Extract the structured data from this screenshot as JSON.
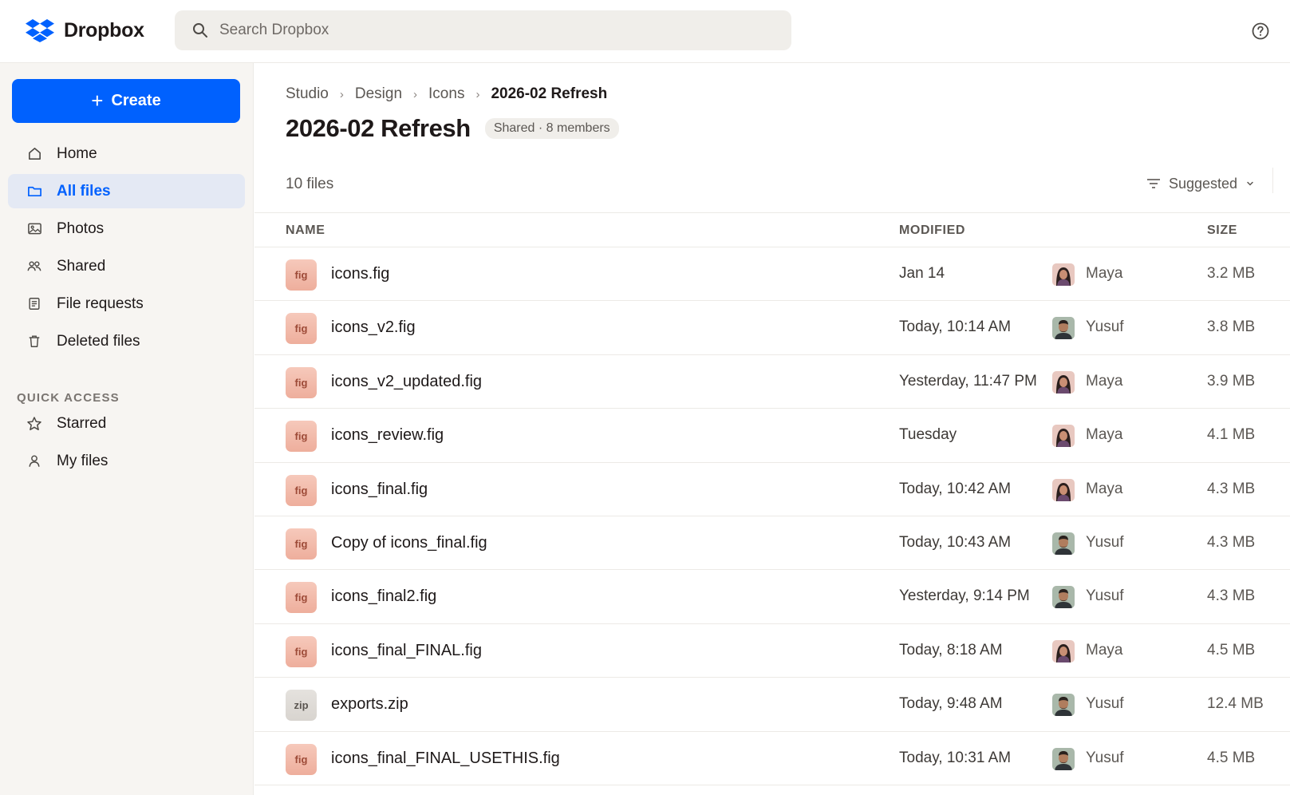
{
  "header": {
    "brand": "Dropbox",
    "search_placeholder": "Search Dropbox",
    "colors": {
      "brand_blue": "#0061fe"
    }
  },
  "sidebar": {
    "create_label": "Create",
    "items": [
      {
        "label": "Home",
        "icon": "home-icon",
        "active": false
      },
      {
        "label": "All files",
        "icon": "folder-icon",
        "active": true
      },
      {
        "label": "Photos",
        "icon": "photo-icon",
        "active": false
      },
      {
        "label": "Shared",
        "icon": "people-icon",
        "active": false
      },
      {
        "label": "File requests",
        "icon": "file-request-icon",
        "active": false
      },
      {
        "label": "Deleted files",
        "icon": "trash-icon",
        "active": false
      }
    ],
    "quick_access_label": "QUICK ACCESS",
    "quick_access": [
      {
        "label": "Starred",
        "icon": "star-icon"
      },
      {
        "label": "My files",
        "icon": "person-icon"
      }
    ]
  },
  "main": {
    "breadcrumb": [
      "Studio",
      "Design",
      "Icons",
      "2026-02 Refresh"
    ],
    "title": "2026-02 Refresh",
    "shared_badge": "Shared · 8 members",
    "file_count": "10 files",
    "sort_label": "Suggested",
    "columns": {
      "name": "NAME",
      "modified": "MODIFIED",
      "size": "SIZE"
    },
    "files": [
      {
        "type": "fig",
        "name": "icons.fig",
        "modified": "Jan 14",
        "owner": "Maya",
        "size": "3.2 MB"
      },
      {
        "type": "fig",
        "name": "icons_v2.fig",
        "modified": "Today, 10:14 AM",
        "owner": "Yusuf",
        "size": "3.8 MB"
      },
      {
        "type": "fig",
        "name": "icons_v2_updated.fig",
        "modified": "Yesterday, 11:47 PM",
        "owner": "Maya",
        "size": "3.9 MB"
      },
      {
        "type": "fig",
        "name": "icons_review.fig",
        "modified": "Tuesday",
        "owner": "Maya",
        "size": "4.1 MB"
      },
      {
        "type": "fig",
        "name": "icons_final.fig",
        "modified": "Today, 10:42 AM",
        "owner": "Maya",
        "size": "4.3 MB"
      },
      {
        "type": "fig",
        "name": "Copy of icons_final.fig",
        "modified": "Today, 10:43 AM",
        "owner": "Yusuf",
        "size": "4.3 MB"
      },
      {
        "type": "fig",
        "name": "icons_final2.fig",
        "modified": "Yesterday, 9:14 PM",
        "owner": "Yusuf",
        "size": "4.3 MB"
      },
      {
        "type": "fig",
        "name": "icons_final_FINAL.fig",
        "modified": "Today, 8:18 AM",
        "owner": "Maya",
        "size": "4.5 MB"
      },
      {
        "type": "zip",
        "name": "exports.zip",
        "modified": "Today, 9:48 AM",
        "owner": "Yusuf",
        "size": "12.4 MB"
      },
      {
        "type": "fig",
        "name": "icons_final_FINAL_USETHIS.fig",
        "modified": "Today, 10:31 AM",
        "owner": "Yusuf",
        "size": "4.5 MB"
      }
    ]
  }
}
